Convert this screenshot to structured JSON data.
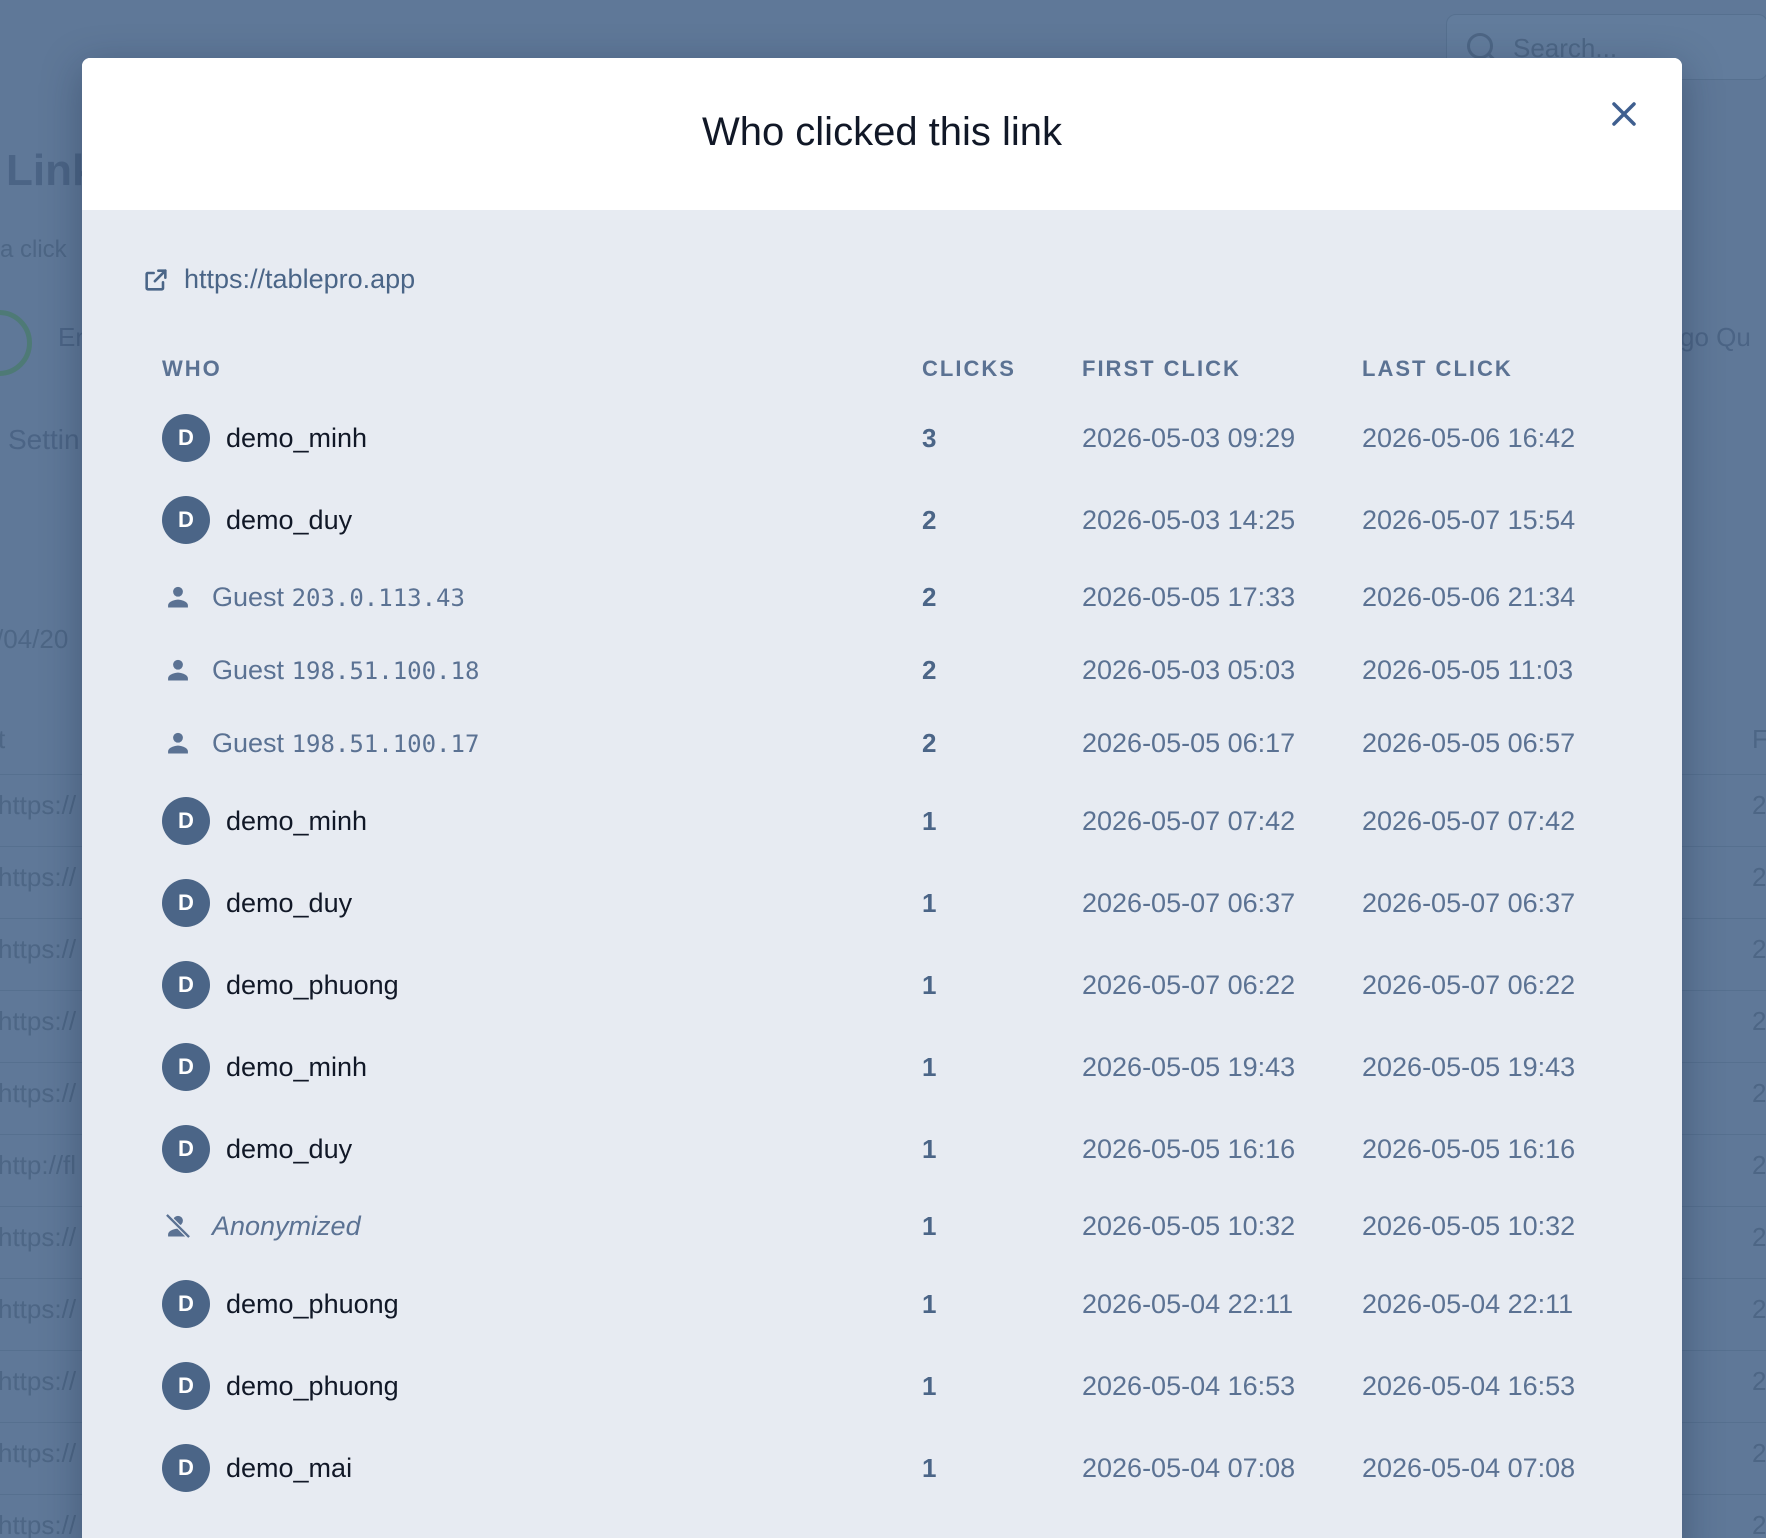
{
  "background": {
    "search_placeholder": "Search...",
    "title_fragment": "Link",
    "subtitle_fragment": "a click",
    "toggle_fragment": "En",
    "right_fragment": "go Qu",
    "settings_fragment": "Settin",
    "date_fragment": "/04/20",
    "column_fragment_left": "t",
    "column_fragment_right": "F",
    "row_fragments": [
      "https://",
      "https://",
      "https://",
      "https://",
      "https://",
      "http://fl",
      "https://",
      "https://",
      "https://",
      "https://",
      "https://"
    ],
    "row_right_fragments": [
      "2",
      "2",
      "2",
      "2",
      "2",
      "2",
      "2",
      "2",
      "2",
      "2",
      "2"
    ]
  },
  "modal": {
    "title": "Who clicked this link",
    "url": "https://tablepro.app",
    "columns": {
      "who": "WHO",
      "clicks": "CLICKS",
      "first_click": "FIRST CLICK",
      "last_click": "LAST CLICK"
    },
    "rows": [
      {
        "kind": "user",
        "initial": "D",
        "name": "demo_minh",
        "clicks": "3",
        "first": "2026-05-03 09:29",
        "last": "2026-05-06 16:42"
      },
      {
        "kind": "user",
        "initial": "D",
        "name": "demo_duy",
        "clicks": "2",
        "first": "2026-05-03 14:25",
        "last": "2026-05-07 15:54"
      },
      {
        "kind": "guest",
        "label": "Guest",
        "ip": "203.0.113.43",
        "clicks": "2",
        "first": "2026-05-05 17:33",
        "last": "2026-05-06 21:34"
      },
      {
        "kind": "guest",
        "label": "Guest",
        "ip": "198.51.100.18",
        "clicks": "2",
        "first": "2026-05-03 05:03",
        "last": "2026-05-05 11:03"
      },
      {
        "kind": "guest",
        "label": "Guest",
        "ip": "198.51.100.17",
        "clicks": "2",
        "first": "2026-05-05 06:17",
        "last": "2026-05-05 06:57"
      },
      {
        "kind": "user",
        "initial": "D",
        "name": "demo_minh",
        "clicks": "1",
        "first": "2026-05-07 07:42",
        "last": "2026-05-07 07:42"
      },
      {
        "kind": "user",
        "initial": "D",
        "name": "demo_duy",
        "clicks": "1",
        "first": "2026-05-07 06:37",
        "last": "2026-05-07 06:37"
      },
      {
        "kind": "user",
        "initial": "D",
        "name": "demo_phuong",
        "clicks": "1",
        "first": "2026-05-07 06:22",
        "last": "2026-05-07 06:22"
      },
      {
        "kind": "user",
        "initial": "D",
        "name": "demo_minh",
        "clicks": "1",
        "first": "2026-05-05 19:43",
        "last": "2026-05-05 19:43"
      },
      {
        "kind": "user",
        "initial": "D",
        "name": "demo_duy",
        "clicks": "1",
        "first": "2026-05-05 16:16",
        "last": "2026-05-05 16:16"
      },
      {
        "kind": "anonymized",
        "name": "Anonymized",
        "clicks": "1",
        "first": "2026-05-05 10:32",
        "last": "2026-05-05 10:32"
      },
      {
        "kind": "user",
        "initial": "D",
        "name": "demo_phuong",
        "clicks": "1",
        "first": "2026-05-04 22:11",
        "last": "2026-05-04 22:11"
      },
      {
        "kind": "user",
        "initial": "D",
        "name": "demo_phuong",
        "clicks": "1",
        "first": "2026-05-04 16:53",
        "last": "2026-05-04 16:53"
      },
      {
        "kind": "user",
        "initial": "D",
        "name": "demo_mai",
        "clicks": "1",
        "first": "2026-05-04 07:08",
        "last": "2026-05-04 07:08"
      }
    ]
  },
  "icons": {
    "close": "close-icon",
    "external_link": "external-link-icon",
    "guest": "person-icon",
    "anonymized": "person-off-icon",
    "search": "search-icon"
  },
  "colors": {
    "overlay": "#5f7898",
    "modal_body": "#e7ebf2",
    "header": "#ffffff",
    "avatar": "#4b6587",
    "accent_text": "#4a6587",
    "muted_text": "#5b7293"
  }
}
